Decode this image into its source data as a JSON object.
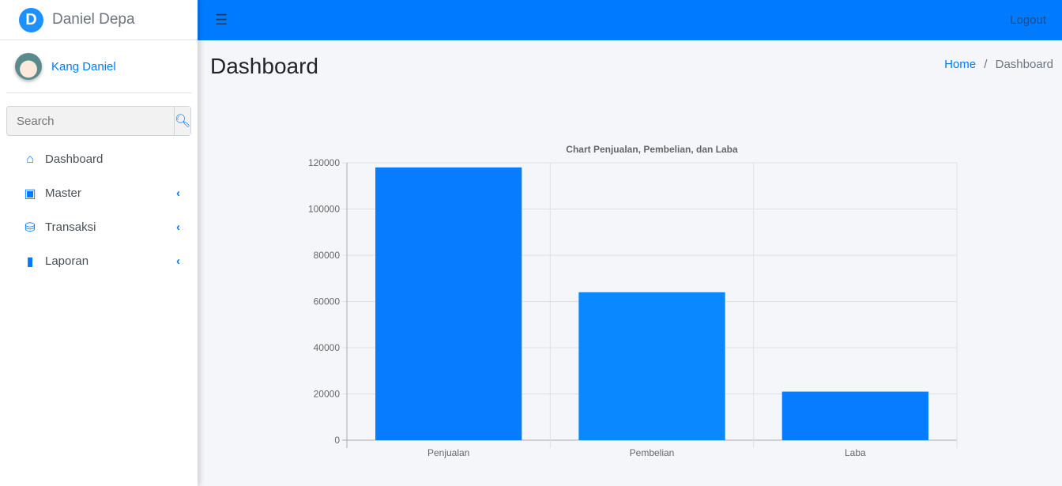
{
  "brand": {
    "name": "Daniel Depa",
    "logo_letter": "D"
  },
  "user": {
    "name": "Kang Daniel"
  },
  "search": {
    "placeholder": "Search",
    "icon": "search-icon"
  },
  "nav": [
    {
      "label": "Dashboard",
      "icon": "home-icon"
    },
    {
      "label": "Master",
      "icon": "dolly-icon",
      "has_submenu": true
    },
    {
      "label": "Transaksi",
      "icon": "coins-icon",
      "has_submenu": true
    },
    {
      "label": "Laporan",
      "icon": "book-icon",
      "has_submenu": true
    }
  ],
  "topbar": {
    "menu_icon": "bars-icon",
    "logout": "Logout"
  },
  "page": {
    "title": "Dashboard",
    "breadcrumb": {
      "home": "Home",
      "sep": "/",
      "current": "Dashboard"
    }
  },
  "colors": {
    "primary": "#007bff",
    "bar": "#077cff"
  },
  "chart_data": {
    "type": "bar",
    "title": "Chart Penjualan, Pembelian, dan Laba",
    "categories": [
      "Penjualan",
      "Pembelian",
      "Laba"
    ],
    "values": [
      118000,
      64000,
      21000
    ],
    "ylim": [
      0,
      120000
    ],
    "yticks": [
      0,
      20000,
      40000,
      60000,
      80000,
      100000,
      120000
    ],
    "grid": true
  }
}
